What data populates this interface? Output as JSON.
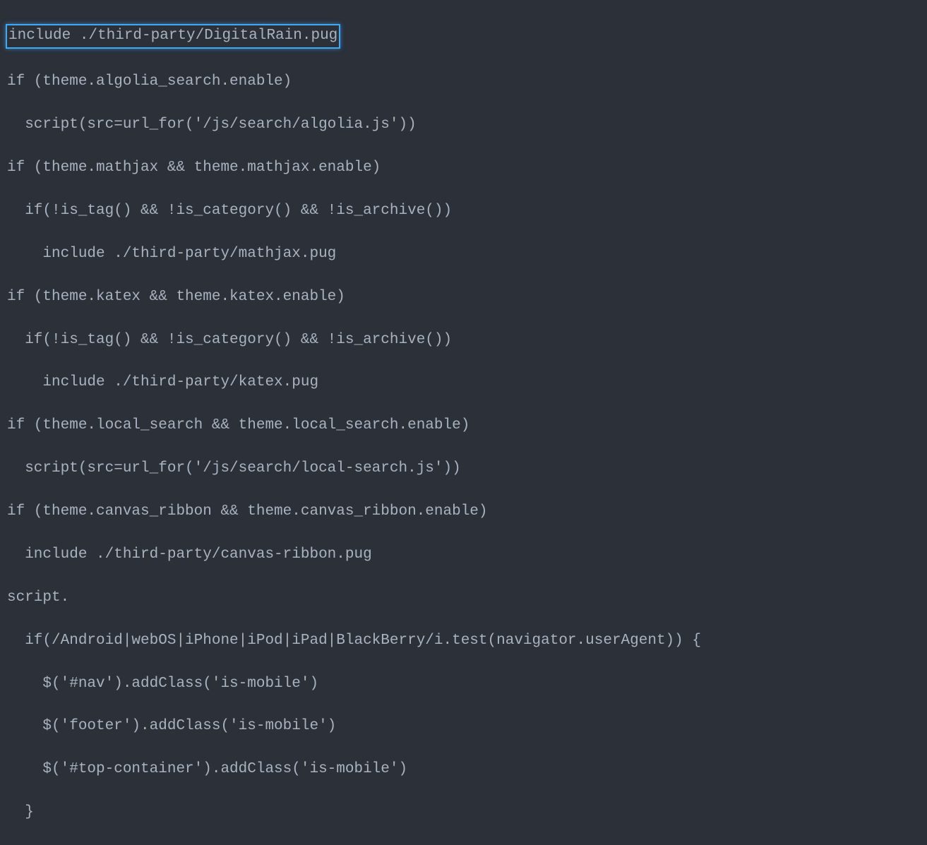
{
  "code": {
    "line1": "include ./third-party/DigitalRain.pug",
    "line2": "if (theme.algolia_search.enable)",
    "line3": "  script(src=url_for('/js/search/algolia.js'))",
    "line4": "if (theme.mathjax && theme.mathjax.enable)",
    "line5": "  if(!is_tag() && !is_category() && !is_archive())",
    "line6": "    include ./third-party/mathjax.pug",
    "line7": "if (theme.katex && theme.katex.enable)",
    "line8": "  if(!is_tag() && !is_category() && !is_archive())",
    "line9": "    include ./third-party/katex.pug",
    "line10": "if (theme.local_search && theme.local_search.enable)",
    "line11": "  script(src=url_for('/js/search/local-search.js'))",
    "line12": "if (theme.canvas_ribbon && theme.canvas_ribbon.enable)",
    "line13": "  include ./third-party/canvas-ribbon.pug",
    "line14": "script.",
    "line15": "  if(/Android|webOS|iPhone|iPod|iPad|BlackBerry/i.test(navigator.userAgent)) {",
    "line16": "    $('#nav').addClass('is-mobile')",
    "line17": "    $('footer').addClass('is-mobile')",
    "line18": "    $('#top-container').addClass('is-mobile')",
    "line19": "  }"
  }
}
